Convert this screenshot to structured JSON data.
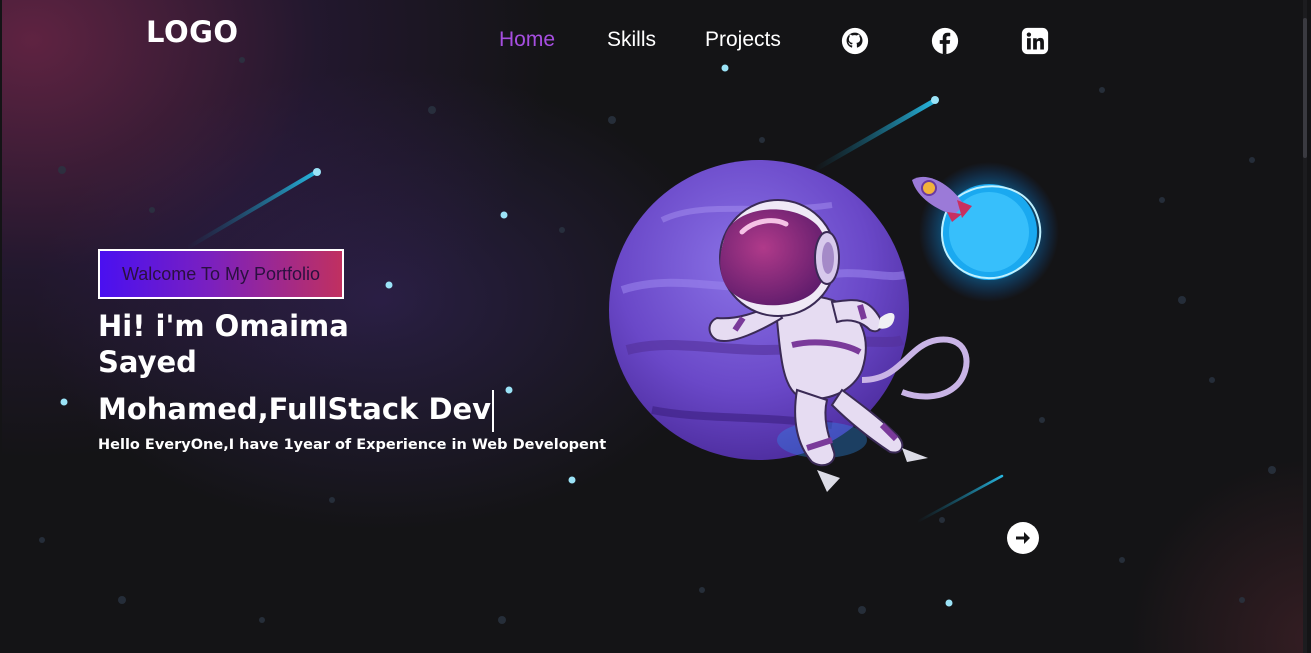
{
  "header": {
    "logo": "LOGO",
    "nav": [
      {
        "label": "Home",
        "active": true
      },
      {
        "label": "Skills",
        "active": false
      },
      {
        "label": "Projects",
        "active": false
      }
    ],
    "social_icons": [
      "github-icon",
      "facebook-icon",
      "linkedin-icon"
    ]
  },
  "hero": {
    "welcome": "Walcome To My Portfolio",
    "headline_line1": "Hi! i'm Omaima",
    "headline_line2": "Sayed",
    "role": "Mohamed,FullStack Dev",
    "subtitle": "Hello EveryOne,I have 1year of Experience in Web Developent"
  },
  "colors": {
    "background": "#141416",
    "nav_active": "#a64ee0",
    "welcome_gradient_start": "#4a10f0",
    "welcome_gradient_end": "#c03060",
    "star": "#9be3f7"
  },
  "icons": {
    "next_button": "arrow-right-circle-icon",
    "illustration": "astronaut-planet-illustration"
  }
}
